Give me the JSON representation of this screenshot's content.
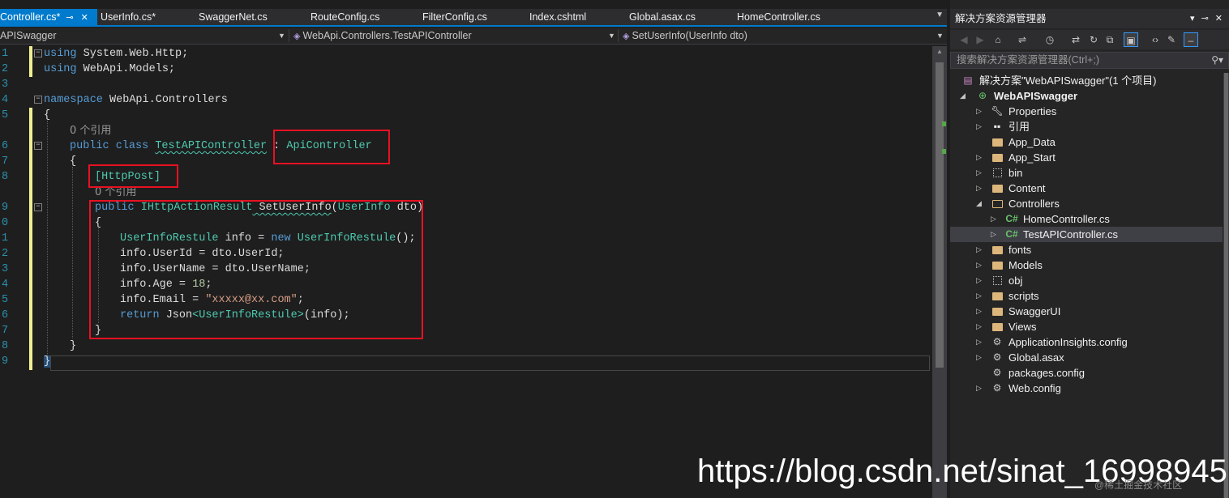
{
  "tabs": [
    {
      "label": "Controller.cs*",
      "active": true
    },
    {
      "label": "UserInfo.cs*"
    },
    {
      "label": "SwaggerNet.cs"
    },
    {
      "label": "RouteConfig.cs"
    },
    {
      "label": "FilterConfig.cs"
    },
    {
      "label": "Index.cshtml"
    },
    {
      "label": "Global.asax.cs"
    },
    {
      "label": "HomeController.cs"
    }
  ],
  "navbar": {
    "project": "APISwagger",
    "class": "WebApi.Controllers.TestAPIController",
    "member": "SetUserInfo(UserInfo dto)"
  },
  "code": {
    "line_numbers": [
      "1",
      "2",
      "3",
      "4",
      "5",
      "6",
      "7",
      "8",
      "9",
      "0",
      "1",
      "2",
      "3",
      "4",
      "5",
      "6",
      "7",
      "8",
      "9"
    ],
    "using1_kw": "using",
    "using1_ns": " System.Web.Http;",
    "using2_kw": "using",
    "using2_ns": " WebApi.Models;",
    "ns_kw": "namespace",
    "ns_name": " WebApi.Controllers",
    "brace_open": "{",
    "ref0": "0 个引用",
    "class_mods": "public class ",
    "class_name": "TestAPIController",
    "class_colon": " : ",
    "class_base": "ApiController",
    "class_open": "{",
    "attr": "[HttpPost]",
    "ref1": "0 个引用",
    "method_kw": "public ",
    "method_ret": "IHttpActionResult",
    "method_name": " SetUserInfo",
    "method_paren": "(",
    "method_ptype": "UserInfo",
    "method_pname": " dto)",
    "method_open": "{",
    "l1_type": "UserInfoRestule",
    "l1_mid": " info = ",
    "l1_new": "new ",
    "l1_ctor": "UserInfoRestule",
    "l1_end": "();",
    "l2": "info.UserId = dto.UserId;",
    "l3": "info.UserName = dto.UserName;",
    "l4_a": "info.Age = ",
    "l4_num": "18",
    "l4_end": ";",
    "l5_a": "info.Email = ",
    "l5_str": "\"xxxxx@xx.com\"",
    "l5_end": ";",
    "l6_kw": "return",
    "l6_a": " Json",
    "l6_lt": "<",
    "l6_type": "UserInfoRestule",
    "l6_gt": ">",
    "l6_end": "(info);",
    "method_close": "}",
    "class_close": "}",
    "ns_close": "}"
  },
  "explorer": {
    "title": "解决方案资源管理器",
    "search_placeholder": "搜索解决方案资源管理器(Ctrl+;)",
    "solution": "解决方案\"WebAPISwagger\"(1 个项目)",
    "project": "WebAPISwagger",
    "items": [
      {
        "label": "Properties",
        "icon": "wrench-icon"
      },
      {
        "label": "引用",
        "icon": "references-icon"
      },
      {
        "label": "App_Data",
        "icon": "folder-icon"
      },
      {
        "label": "App_Start",
        "icon": "folder-icon"
      },
      {
        "label": "bin",
        "icon": "hidden-folder-icon"
      },
      {
        "label": "Content",
        "icon": "folder-icon"
      },
      {
        "label": "Controllers",
        "icon": "folder-icon"
      },
      {
        "label": "HomeController.cs",
        "icon": "csharp-file-icon"
      },
      {
        "label": "TestAPIController.cs",
        "icon": "csharp-file-icon"
      },
      {
        "label": "fonts",
        "icon": "folder-icon"
      },
      {
        "label": "Models",
        "icon": "folder-icon"
      },
      {
        "label": "obj",
        "icon": "hidden-folder-icon"
      },
      {
        "label": "scripts",
        "icon": "folder-icon"
      },
      {
        "label": "SwaggerUI",
        "icon": "folder-icon"
      },
      {
        "label": "Views",
        "icon": "folder-icon"
      },
      {
        "label": "ApplicationInsights.config",
        "icon": "config-file-icon"
      },
      {
        "label": "Global.asax",
        "icon": "file-icon"
      },
      {
        "label": "packages.config",
        "icon": "config-file-icon"
      },
      {
        "label": "Web.config",
        "icon": "config-file-icon"
      }
    ]
  },
  "watermark": "https://blog.csdn.net/sinat_16998945",
  "watermark_small": "@稀土掘金技术社区",
  "colors": {
    "keyword": "#569cd6",
    "type": "#4ec9b0",
    "string": "#d69d85",
    "number": "#b5cea8",
    "highlight_box": "#e81123",
    "accent": "#007acc"
  }
}
